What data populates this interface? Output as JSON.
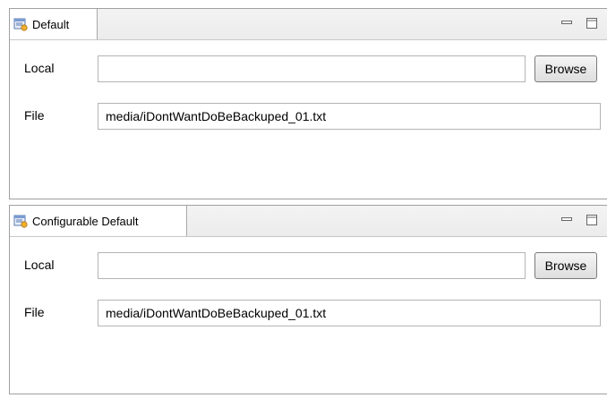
{
  "panels": [
    {
      "tab_title": "Default",
      "local_label": "Local",
      "local_value": "",
      "browse_label": "Browse",
      "file_label": "File",
      "file_value": "media/iDontWantDoBeBackuped_01.txt"
    },
    {
      "tab_title": "Configurable Default",
      "local_label": "Local",
      "local_value": "",
      "browse_label": "Browse",
      "file_label": "File",
      "file_value": "media/iDontWantDoBeBackuped_01.txt"
    }
  ],
  "icons": {
    "tab": "editor-tab-icon",
    "minimize": "minimize-icon",
    "maximize": "maximize-icon"
  },
  "colors": {
    "border": "#a0a0a0",
    "tab_bar": "#ececec",
    "button_border": "#7a7a7a"
  }
}
